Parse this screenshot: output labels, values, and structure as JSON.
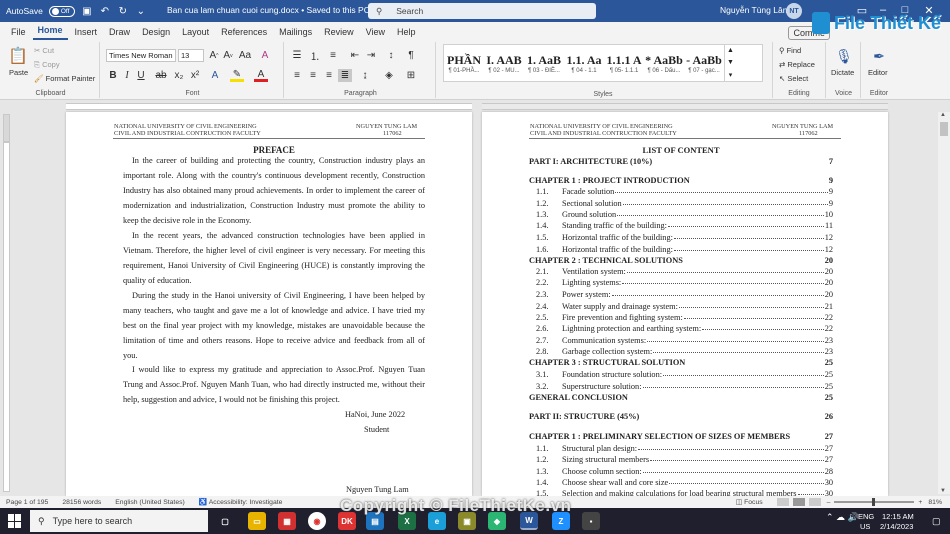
{
  "titlebar": {
    "autosave": "AutoSave",
    "autosave_state": "Off",
    "document_title": "Ban cua lam chuan cuoi cung.docx • Saved to this PC ⌄",
    "search_placeholder": "Search",
    "user_name": "Nguyễn Tùng Lâm",
    "user_initials": "NT"
  },
  "menu": {
    "tabs": [
      "File",
      "Home",
      "Insert",
      "Draw",
      "Design",
      "Layout",
      "References",
      "Mailings",
      "Review",
      "View",
      "Help"
    ],
    "active": "Home",
    "comments_label": "Comme"
  },
  "ribbon": {
    "clipboard": {
      "paste": "Paste",
      "cut": "Cut",
      "copy": "Copy",
      "format_painter": "Format Painter",
      "group": "Clipboard"
    },
    "font": {
      "font_name": "Times New Roman",
      "font_size": "13",
      "group": "Font"
    },
    "paragraph": {
      "group": "Paragraph"
    },
    "styles": {
      "group": "Styles",
      "items": [
        {
          "preview": "PHẦN",
          "name": "¶ 01-PHẦ..."
        },
        {
          "preview": "I.  AAB",
          "name": "¶ 02 - MU..."
        },
        {
          "preview": "1.  AaB",
          "name": "¶ 03 - ĐIỀ..."
        },
        {
          "preview": "1.1.  Aa",
          "name": "¶ 04 - 1.1"
        },
        {
          "preview": "1.1.1  A",
          "name": "¶ 05- 1.1.1"
        },
        {
          "preview": "*  AaBb",
          "name": "¶ 06 - Dấu..."
        },
        {
          "preview": "-  AaBb",
          "name": "¶ 07 - gạc..."
        }
      ]
    },
    "editing": {
      "find": "Find",
      "replace": "Replace",
      "select": "Select",
      "group": "Editing"
    },
    "voice": {
      "dictate": "Dictate",
      "group": "Voice"
    },
    "editor": {
      "editor": "Editor",
      "group": "Editor"
    }
  },
  "logo_text": "File Thiết Kế",
  "left_page": {
    "header_left_1": "NATIONAL UNIVERSITY OF CIVIL ENGINEERING",
    "header_left_2": "CIVIL AND INDUSTRIAL CONTRUCTION FACULTY",
    "header_right_1": "NGUYEN TUNG LAM",
    "header_right_2": "117062",
    "title": "PREFACE",
    "paragraphs": [
      "In the career of building and protecting the country, Construction industry plays an important role. Along with the country's continuous development recently, Construction Industry has also obtained many proud achievements. In order to implement the career of modernization and industrialization, Construction Industry must promote the ability to keep the decisive role in the Economy.",
      "In the recent years, the advanced construction technologies have been applied in Vietnam. Therefore, the higher level of civil engineer is very necessary. For meeting this requirement, Hanoi University of Civil Engineering (HUCE) is constantly improving the quality of education.",
      "During the study in the Hanoi university of Civil Engineering, I have been helped by many teachers, who taught and gave me a lot of knowledge and advice. I have tried my best on the final year project with my knowledge, mistakes are unavoidable because the limitation of time and others reasons. Hope to receive advice and feedback from all of you.",
      "I would like to express my gratitude and appreciation to Assoc.Prof. Nguyen Tuan Trung and Assoc.Prof. Nguyen Manh Tuan, who had directly instructed me, without their help, suggestion and advice, I would not be finishing this project."
    ],
    "date": "HaNoi, June 2022",
    "signer_role": "Student",
    "signer_name": "Nguyen Tung Lam"
  },
  "right_page": {
    "header_left_1": "NATIONAL UNIVERSITY OF CIVIL ENGINEERING",
    "header_left_2": "CIVIL AND INDUSTRIAL CONTRUCTION FACULTY",
    "header_right_1": "NGUYEN TUNG LAM",
    "header_right_2": "117062",
    "title": "LIST OF CONTENT",
    "entries": [
      {
        "type": "ch",
        "text": "PART I: ARCHITECTURE (10%)",
        "page": "7"
      },
      {
        "type": "ch",
        "text": "CHAPTER 1 : PROJECT INTRODUCTION",
        "page": "9"
      },
      {
        "type": "sub",
        "num": "1.1.",
        "text": "Facade solution",
        "page": "9"
      },
      {
        "type": "sub",
        "num": "1.2.",
        "text": "Sectional solution",
        "page": "9"
      },
      {
        "type": "sub",
        "num": "1.3.",
        "text": "Ground solution",
        "page": "10"
      },
      {
        "type": "sub",
        "num": "1.4.",
        "text": "Standing traffic of the building:",
        "page": "11"
      },
      {
        "type": "sub",
        "num": "1.5.",
        "text": "Horizontal traffic of the building:",
        "page": "12"
      },
      {
        "type": "sub",
        "num": "1.6.",
        "text": "Horizontal traffic of the building:",
        "page": "12"
      },
      {
        "type": "ch",
        "text": "CHAPTER 2 : TECHNICAL SOLUTIONS",
        "page": "20"
      },
      {
        "type": "sub",
        "num": "2.1.",
        "text": "Ventilation system:",
        "page": "20"
      },
      {
        "type": "sub",
        "num": "2.2.",
        "text": "Lighting systems:",
        "page": "20"
      },
      {
        "type": "sub",
        "num": "2.3.",
        "text": "Power system:",
        "page": "20"
      },
      {
        "type": "sub",
        "num": "2.4.",
        "text": "Water supply and drainage system:",
        "page": "21"
      },
      {
        "type": "sub",
        "num": "2.5.",
        "text": "Fire prevention and fighting system:",
        "page": "22"
      },
      {
        "type": "sub",
        "num": "2.6.",
        "text": "Lightning protection and earthing system:",
        "page": "22"
      },
      {
        "type": "sub",
        "num": "2.7.",
        "text": "Communication systems:",
        "page": "23"
      },
      {
        "type": "sub",
        "num": "2.8.",
        "text": "Garbage collection system:",
        "page": "23"
      },
      {
        "type": "ch",
        "text": "CHAPTER 3 : STRUCTURAL SOLUTION",
        "page": "25"
      },
      {
        "type": "sub",
        "num": "3.1.",
        "text": "Foundation structure solution:",
        "page": "25"
      },
      {
        "type": "sub",
        "num": "3.2.",
        "text": "Superstructure solution:",
        "page": "25"
      },
      {
        "type": "ch",
        "text": "GENERAL CONCLUSION",
        "page": "25"
      },
      {
        "type": "ch",
        "text": "PART II: STRUCTURE (45%)",
        "page": "26"
      },
      {
        "type": "ch",
        "text": "CHAPTER 1 : PRELIMINARY SELECTION OF SIZES OF MEMBERS",
        "page": "27"
      },
      {
        "type": "sub",
        "num": "1.1.",
        "text": "Structural plan design:",
        "page": "27"
      },
      {
        "type": "sub",
        "num": "1.2.",
        "text": "Sizing structural members",
        "page": "27"
      },
      {
        "type": "sub",
        "num": "1.3.",
        "text": "Choose column section:",
        "page": "28"
      },
      {
        "type": "sub",
        "num": "1.4.",
        "text": "Choose shear wall and core size",
        "page": "30"
      },
      {
        "type": "sub",
        "num": "1.5.",
        "text": "Selection and making calculations for load bearing structural members",
        "page": "30"
      }
    ]
  },
  "status": {
    "page": "Page 1 of 195",
    "words": "28156 words",
    "language": "English (United States)",
    "accessibility": "Accessibility: Investigate",
    "focus": "Focus",
    "zoom": "81%"
  },
  "watermark": "Copyright © FileThietKe.vn",
  "taskbar": {
    "search": "Type here to search",
    "lang1": "ENG",
    "lang2": "US",
    "time": "12:15 AM",
    "date": "2/14/2023"
  }
}
